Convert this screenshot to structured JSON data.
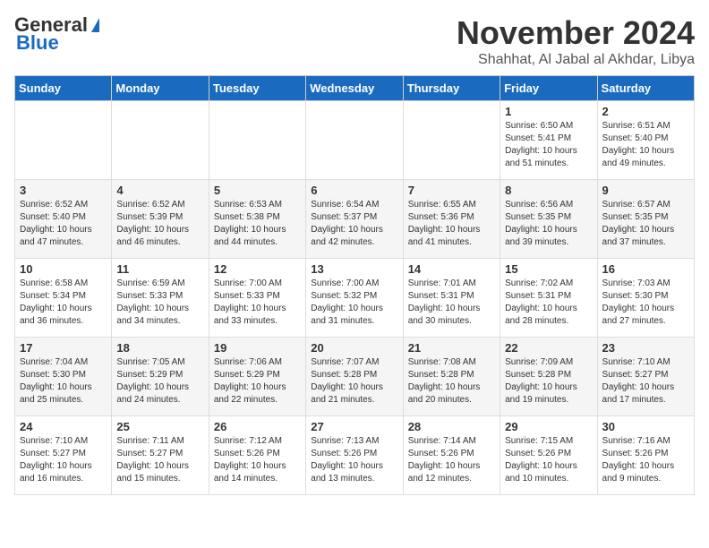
{
  "header": {
    "logo_line1": "General",
    "logo_line2": "Blue",
    "month_title": "November 2024",
    "location": "Shahhat, Al Jabal al Akhdar, Libya"
  },
  "weekdays": [
    "Sunday",
    "Monday",
    "Tuesday",
    "Wednesday",
    "Thursday",
    "Friday",
    "Saturday"
  ],
  "weeks": [
    [
      {
        "day": "",
        "info": ""
      },
      {
        "day": "",
        "info": ""
      },
      {
        "day": "",
        "info": ""
      },
      {
        "day": "",
        "info": ""
      },
      {
        "day": "",
        "info": ""
      },
      {
        "day": "1",
        "info": "Sunrise: 6:50 AM\nSunset: 5:41 PM\nDaylight: 10 hours\nand 51 minutes."
      },
      {
        "day": "2",
        "info": "Sunrise: 6:51 AM\nSunset: 5:40 PM\nDaylight: 10 hours\nand 49 minutes."
      }
    ],
    [
      {
        "day": "3",
        "info": "Sunrise: 6:52 AM\nSunset: 5:40 PM\nDaylight: 10 hours\nand 47 minutes."
      },
      {
        "day": "4",
        "info": "Sunrise: 6:52 AM\nSunset: 5:39 PM\nDaylight: 10 hours\nand 46 minutes."
      },
      {
        "day": "5",
        "info": "Sunrise: 6:53 AM\nSunset: 5:38 PM\nDaylight: 10 hours\nand 44 minutes."
      },
      {
        "day": "6",
        "info": "Sunrise: 6:54 AM\nSunset: 5:37 PM\nDaylight: 10 hours\nand 42 minutes."
      },
      {
        "day": "7",
        "info": "Sunrise: 6:55 AM\nSunset: 5:36 PM\nDaylight: 10 hours\nand 41 minutes."
      },
      {
        "day": "8",
        "info": "Sunrise: 6:56 AM\nSunset: 5:35 PM\nDaylight: 10 hours\nand 39 minutes."
      },
      {
        "day": "9",
        "info": "Sunrise: 6:57 AM\nSunset: 5:35 PM\nDaylight: 10 hours\nand 37 minutes."
      }
    ],
    [
      {
        "day": "10",
        "info": "Sunrise: 6:58 AM\nSunset: 5:34 PM\nDaylight: 10 hours\nand 36 minutes."
      },
      {
        "day": "11",
        "info": "Sunrise: 6:59 AM\nSunset: 5:33 PM\nDaylight: 10 hours\nand 34 minutes."
      },
      {
        "day": "12",
        "info": "Sunrise: 7:00 AM\nSunset: 5:33 PM\nDaylight: 10 hours\nand 33 minutes."
      },
      {
        "day": "13",
        "info": "Sunrise: 7:00 AM\nSunset: 5:32 PM\nDaylight: 10 hours\nand 31 minutes."
      },
      {
        "day": "14",
        "info": "Sunrise: 7:01 AM\nSunset: 5:31 PM\nDaylight: 10 hours\nand 30 minutes."
      },
      {
        "day": "15",
        "info": "Sunrise: 7:02 AM\nSunset: 5:31 PM\nDaylight: 10 hours\nand 28 minutes."
      },
      {
        "day": "16",
        "info": "Sunrise: 7:03 AM\nSunset: 5:30 PM\nDaylight: 10 hours\nand 27 minutes."
      }
    ],
    [
      {
        "day": "17",
        "info": "Sunrise: 7:04 AM\nSunset: 5:30 PM\nDaylight: 10 hours\nand 25 minutes."
      },
      {
        "day": "18",
        "info": "Sunrise: 7:05 AM\nSunset: 5:29 PM\nDaylight: 10 hours\nand 24 minutes."
      },
      {
        "day": "19",
        "info": "Sunrise: 7:06 AM\nSunset: 5:29 PM\nDaylight: 10 hours\nand 22 minutes."
      },
      {
        "day": "20",
        "info": "Sunrise: 7:07 AM\nSunset: 5:28 PM\nDaylight: 10 hours\nand 21 minutes."
      },
      {
        "day": "21",
        "info": "Sunrise: 7:08 AM\nSunset: 5:28 PM\nDaylight: 10 hours\nand 20 minutes."
      },
      {
        "day": "22",
        "info": "Sunrise: 7:09 AM\nSunset: 5:28 PM\nDaylight: 10 hours\nand 19 minutes."
      },
      {
        "day": "23",
        "info": "Sunrise: 7:10 AM\nSunset: 5:27 PM\nDaylight: 10 hours\nand 17 minutes."
      }
    ],
    [
      {
        "day": "24",
        "info": "Sunrise: 7:10 AM\nSunset: 5:27 PM\nDaylight: 10 hours\nand 16 minutes."
      },
      {
        "day": "25",
        "info": "Sunrise: 7:11 AM\nSunset: 5:27 PM\nDaylight: 10 hours\nand 15 minutes."
      },
      {
        "day": "26",
        "info": "Sunrise: 7:12 AM\nSunset: 5:26 PM\nDaylight: 10 hours\nand 14 minutes."
      },
      {
        "day": "27",
        "info": "Sunrise: 7:13 AM\nSunset: 5:26 PM\nDaylight: 10 hours\nand 13 minutes."
      },
      {
        "day": "28",
        "info": "Sunrise: 7:14 AM\nSunset: 5:26 PM\nDaylight: 10 hours\nand 12 minutes."
      },
      {
        "day": "29",
        "info": "Sunrise: 7:15 AM\nSunset: 5:26 PM\nDaylight: 10 hours\nand 10 minutes."
      },
      {
        "day": "30",
        "info": "Sunrise: 7:16 AM\nSunset: 5:26 PM\nDaylight: 10 hours\nand 9 minutes."
      }
    ]
  ]
}
